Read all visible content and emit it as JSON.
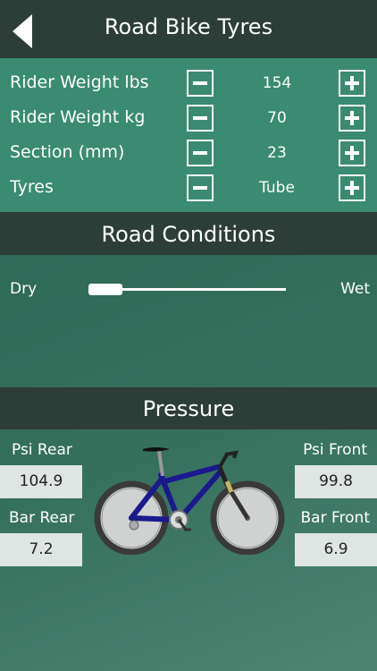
{
  "header": {
    "title": "Road Bike Tyres"
  },
  "settings": {
    "rows": [
      {
        "label": "Rider Weight lbs",
        "value": "154"
      },
      {
        "label": "Rider Weight kg",
        "value": "70"
      },
      {
        "label": "Section (mm)",
        "value": "23"
      },
      {
        "label": "Tyres",
        "value": "Tube"
      }
    ]
  },
  "road": {
    "title": "Road Conditions",
    "dry_label": "Dry",
    "wet_label": "Wet",
    "slider_level": 0.0
  },
  "pressure": {
    "title": "Pressure",
    "psi_rear_label": "Psi Rear",
    "psi_rear_value": "104.9",
    "bar_rear_label": "Bar Rear",
    "bar_rear_value": "7.2",
    "psi_front_label": "Psi Front",
    "psi_front_value": "99.8",
    "bar_front_label": "Bar Front",
    "bar_front_value": "6.9"
  },
  "colors": {
    "header_bg": "#2d3d37",
    "settings_bg": "#3a8b71",
    "bike_frame": "#1a1a8c"
  },
  "icons": {
    "back": "back-arrow-icon",
    "minus": "minus-icon",
    "plus": "plus-icon",
    "bike": "bicycle-icon"
  }
}
